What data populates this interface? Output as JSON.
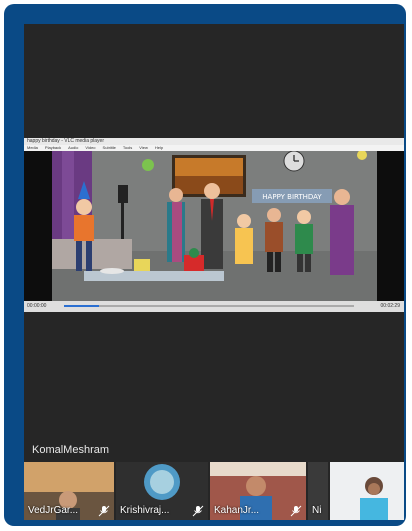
{
  "video": {
    "player_title": "happy birthday - VLC media player",
    "menu": [
      "Media",
      "Playback",
      "Audio",
      "Video",
      "Subtitle",
      "Tools",
      "View",
      "Help"
    ],
    "progress": 0.12,
    "time_elapsed": "00:00:00",
    "time_total": "00:02:29",
    "banner_text": "HAPPY BIRTHDAY"
  },
  "host": {
    "name": "KomalMeshram"
  },
  "participants": [
    {
      "name": "VedJrGar...",
      "muted": true
    },
    {
      "name": "Krishivraj...",
      "muted": true
    },
    {
      "name": "KahanJr...",
      "muted": true
    },
    {
      "name": "Ni",
      "muted": false
    },
    {
      "name": "",
      "muted": false
    }
  ],
  "colors": {
    "frame": "#0a4a86",
    "background": "#262626"
  }
}
